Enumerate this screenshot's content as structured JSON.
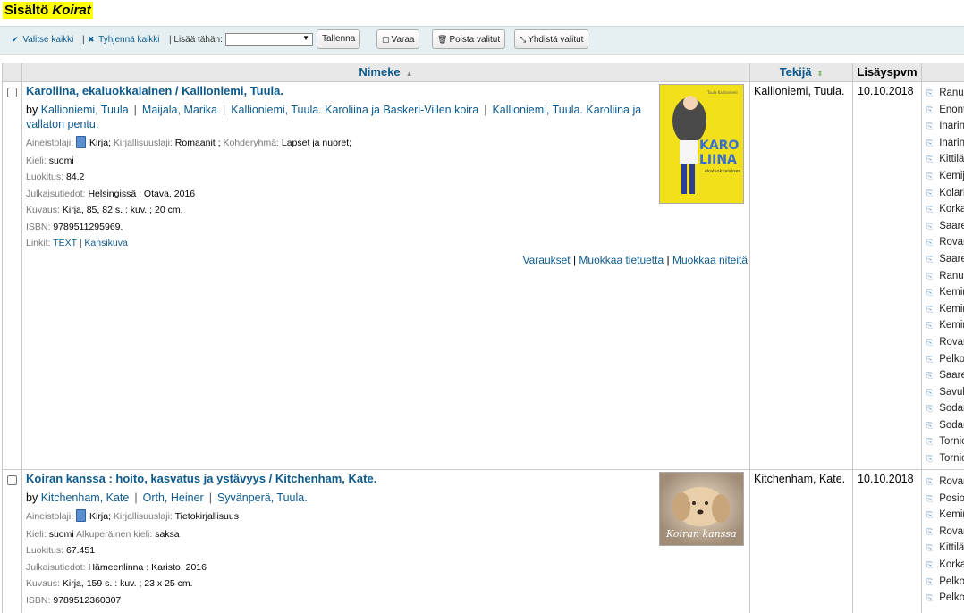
{
  "heading": {
    "prefix": "Sisältö",
    "name": "Koirat"
  },
  "toolbar": {
    "select_all": "Valitse kaikki",
    "clear_all": "Tyhjennä kaikki",
    "add_to_label": "| Lisää tähän:",
    "select_value": "",
    "save": "Tallenna",
    "reserve": "Varaa",
    "remove_selected": "Poista valitut",
    "merge_selected": "Yhdistä valitut"
  },
  "columns": {
    "title": "Nimeke",
    "author": "Tekijä",
    "date_added": "Lisäyspvm"
  },
  "records": [
    {
      "title": "Karoliina, ekaluokkalainen / Kallioniemi, Tuula.",
      "by": "by",
      "authors": [
        "Kallioniemi, Tuula",
        "Maijala, Marika",
        "Kallioniemi, Tuula. Karoliina ja Baskeri-Villen koira",
        "Kallioniemi, Tuula. Karoliina ja vallaton pentu."
      ],
      "material_label": "Aineistolaji:",
      "material": "Kirja",
      "genre_label": "Kirjallisuuslaji:",
      "genre": "Romaanit",
      "audience_label": "Kohderyhmä:",
      "audience": "Lapset ja nuoret;",
      "language_label": "Kieli:",
      "language": "suomi",
      "classification_label": "Luokitus:",
      "classification": "84.2",
      "publication_label": "Julkaisutiedot:",
      "publication": "Helsingissä : Otava, 2016",
      "description_label": "Kuvaus:",
      "description": "Kirja, 85, 82 s. : kuv. ; 20 cm.",
      "isbn_label": "ISBN:",
      "isbn": "9789511295969.",
      "links_label": "Linkit:",
      "link_text": "TEXT",
      "link_cover": "Kansikuva",
      "actions": [
        "Varaukset",
        "Muokkaa tietuetta",
        "Muokkaa niteitä"
      ],
      "cover_author": "Tuula Kallioniemi",
      "cover_title": "KARO LIINA",
      "cover_subtitle": "ekaluokkalainen",
      "cover_color": "#f2e01a",
      "author_col": "Kallioniemi, Tuula.",
      "date": "10.10.2018",
      "libraries": [
        "Ranu",
        "Enont",
        "Inarin",
        "Inarin",
        "Kittilä",
        "Kemij",
        "Kolari",
        "Korka",
        "Saare",
        "Rovar",
        "Saare",
        "Ranu",
        "Kemir",
        "Kemir",
        "Kemir",
        "Rovar",
        "Pelko",
        "Saare",
        "Savul",
        "Sodar",
        "Sodar",
        "Tornic",
        "Tornic"
      ]
    },
    {
      "title": "Koiran kanssa : hoito, kasvatus ja ystävyys / Kitchenham, Kate.",
      "by": "by",
      "authors": [
        "Kitchenham, Kate",
        "Orth, Heiner",
        "Syvänperä, Tuula."
      ],
      "material_label": "Aineistolaji:",
      "material": "Kirja",
      "genre_label": "Kirjallisuuslaji:",
      "genre": "Tietokirjallisuus",
      "language_label": "Kieli:",
      "language": "suomi",
      "orig_language_label": "Alkuperäinen kieli:",
      "orig_language": "saksa",
      "classification_label": "Luokitus:",
      "classification": "67.451",
      "publication_label": "Julkaisutiedot:",
      "publication": "Hämeenlinna : Karisto, 2016",
      "description_label": "Kuvaus:",
      "description": "Kirja, 159 s. : kuv. ; 23 x 25 cm.",
      "isbn_label": "ISBN:",
      "isbn": "9789512360307",
      "cover_title": "Koiran kanssa",
      "cover_color": "#c8b39b",
      "author_col": "Kitchenham, Kate.",
      "date": "10.10.2018",
      "libraries": [
        "Rovar",
        "Posio",
        "Kemir",
        "Rovar",
        "Kittilä",
        "Korka",
        "Pelko",
        "Pelko"
      ]
    }
  ]
}
